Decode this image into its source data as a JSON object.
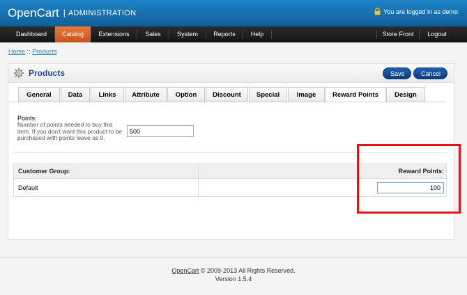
{
  "header": {
    "logo": "OpenCart",
    "separator": "|",
    "admin": "ADMINISTRATION",
    "login_text": "You are logged in as demo"
  },
  "menu": {
    "items": [
      {
        "label": "Dashboard"
      },
      {
        "label": "Catalog",
        "active": true
      },
      {
        "label": "Extensions"
      },
      {
        "label": "Sales"
      },
      {
        "label": "System"
      },
      {
        "label": "Reports"
      },
      {
        "label": "Help"
      }
    ],
    "right": [
      {
        "label": "Store Front"
      },
      {
        "label": "Logout"
      }
    ]
  },
  "breadcrumb": {
    "home": "Home",
    "separator": "::",
    "products": "Products"
  },
  "page": {
    "title": "Products",
    "save_label": "Save",
    "cancel_label": "Cancel"
  },
  "tabs": [
    {
      "label": "General"
    },
    {
      "label": "Data"
    },
    {
      "label": "Links"
    },
    {
      "label": "Attribute"
    },
    {
      "label": "Option"
    },
    {
      "label": "Discount"
    },
    {
      "label": "Special"
    },
    {
      "label": "Image"
    },
    {
      "label": "Reward Points",
      "active": true
    },
    {
      "label": "Design"
    }
  ],
  "form": {
    "points_label": "Points:",
    "points_help": "Number of points needed to buy this item. If you don't want this product to be purchased with points leave as 0.",
    "points_value": "500"
  },
  "reward_table": {
    "header_group": "Customer Group:",
    "header_points": "Reward Points:",
    "rows": [
      {
        "group": "Default",
        "points": "100"
      }
    ]
  },
  "footer": {
    "link": "OpenCart",
    "copyright": " © 2009-2013 All Rights Reserved.",
    "version": "Version 1.5.4"
  },
  "colors": {
    "header_blue": "#1572b6",
    "active_menu": "#d9642a",
    "button_blue": "#164d97",
    "highlight_red": "#e0151b"
  }
}
